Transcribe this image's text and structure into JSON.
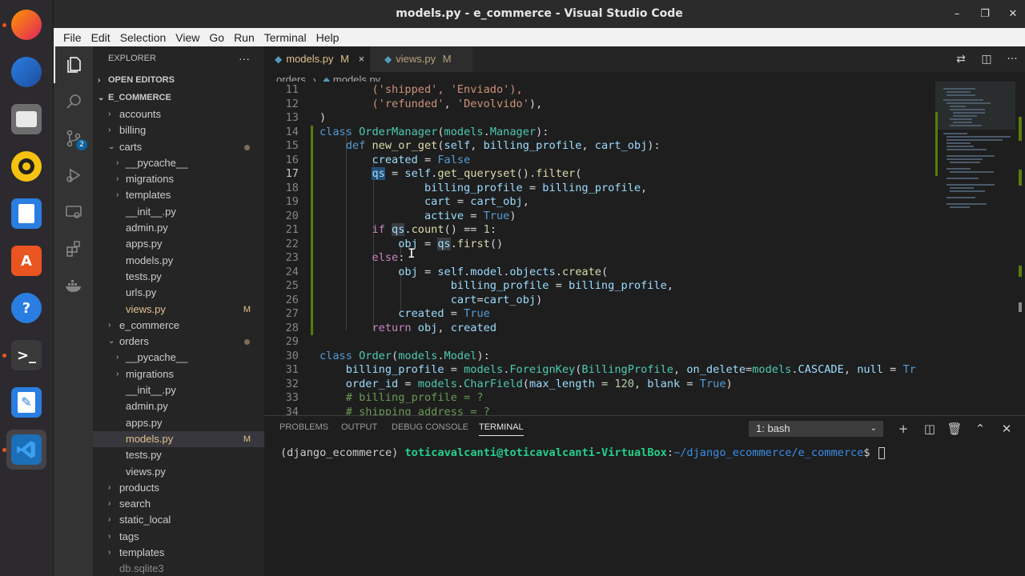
{
  "window": {
    "title": "models.py - e_commerce - Visual Studio Code"
  },
  "menu": [
    "File",
    "Edit",
    "Selection",
    "View",
    "Go",
    "Run",
    "Terminal",
    "Help"
  ],
  "dock": {
    "apps": [
      "firefox-icon",
      "thunderbird-icon",
      "files-icon",
      "rhythmbox-icon",
      "writer-icon",
      "software-center-icon",
      "help-icon",
      "terminal-icon",
      "text-editor-icon",
      "vscode-icon"
    ],
    "terminal_glyph": ">_",
    "help_glyph": "?",
    "software_glyph": "A"
  },
  "activity": {
    "scm_badge": "2"
  },
  "sidebar": {
    "title": "EXPLORER",
    "more": "···",
    "open_editors": "OPEN EDITORS",
    "root": "E_COMMERCE",
    "items": [
      {
        "label": "accounts",
        "indent": 1,
        "chev": "›"
      },
      {
        "label": "billing",
        "indent": 1,
        "chev": "›"
      },
      {
        "label": "carts",
        "indent": 1,
        "chev": "⌄",
        "dot": true
      },
      {
        "label": "__pycache__",
        "indent": 2,
        "chev": "›"
      },
      {
        "label": "migrations",
        "indent": 2,
        "chev": "›"
      },
      {
        "label": "templates",
        "indent": 2,
        "chev": "›"
      },
      {
        "label": "__init__.py",
        "indent": 2
      },
      {
        "label": "admin.py",
        "indent": 2
      },
      {
        "label": "apps.py",
        "indent": 2
      },
      {
        "label": "models.py",
        "indent": 2
      },
      {
        "label": "tests.py",
        "indent": 2
      },
      {
        "label": "urls.py",
        "indent": 2
      },
      {
        "label": "views.py",
        "indent": 2,
        "modified": "M"
      },
      {
        "label": "e_commerce",
        "indent": 1,
        "chev": "›"
      },
      {
        "label": "orders",
        "indent": 1,
        "chev": "⌄",
        "dot": true
      },
      {
        "label": "__pycache__",
        "indent": 2,
        "chev": "›"
      },
      {
        "label": "migrations",
        "indent": 2,
        "chev": "›"
      },
      {
        "label": "__init__.py",
        "indent": 2
      },
      {
        "label": "admin.py",
        "indent": 2
      },
      {
        "label": "apps.py",
        "indent": 2
      },
      {
        "label": "models.py",
        "indent": 2,
        "modified": "M",
        "selected": true
      },
      {
        "label": "tests.py",
        "indent": 2
      },
      {
        "label": "views.py",
        "indent": 2
      },
      {
        "label": "products",
        "indent": 1,
        "chev": "›"
      },
      {
        "label": "search",
        "indent": 1,
        "chev": "›"
      },
      {
        "label": "static_local",
        "indent": 1,
        "chev": "›"
      },
      {
        "label": "tags",
        "indent": 1,
        "chev": "›"
      },
      {
        "label": "templates",
        "indent": 1,
        "chev": "›"
      },
      {
        "label": "db.sqlite3",
        "indent": 1,
        "dim": true
      }
    ]
  },
  "tabs": [
    {
      "label": "models.py",
      "badge": "M",
      "active": true,
      "close": "×"
    },
    {
      "label": "views.py",
      "badge": "M",
      "active": false
    }
  ],
  "breadcrumb": {
    "folder": "orders",
    "sep": "›",
    "file": "models.py"
  },
  "code": {
    "lines": [
      {
        "n": "11",
        "html": "        <span class='str'>('shipped', 'Enviado'),</span>"
      },
      {
        "n": "12",
        "html": "        <span class='str'>('refunded'</span>, <span class='str'>'Devolvido'</span>),"
      },
      {
        "n": "13",
        "html": ")"
      },
      {
        "n": "14",
        "html": "<span class='kw'>class</span> <span class='cls'>OrderManager</span>(<span class='cls'>models</span>.<span class='cls'>Manager</span>):",
        "mod": true
      },
      {
        "n": "15",
        "html": "    <span class='kw'>def</span> <span class='fn'>new_or_get</span>(<span class='var'>self</span>, <span class='var'>billing_profile</span>, <span class='var'>cart_obj</span>):",
        "mod": true
      },
      {
        "n": "16",
        "html": "        <span class='var'>created</span> = <span class='kw'>False</span>",
        "mod": true
      },
      {
        "n": "17",
        "html": "        <span class='var hl'>qs</span> = <span class='var'>self</span>.<span class='fn'>get_queryset</span>().<span class='fn'>filter</span>(",
        "mod": true,
        "cur": true
      },
      {
        "n": "18",
        "html": "                <span class='var'>billing_profile</span> = <span class='var'>billing_profile</span>,",
        "mod": true
      },
      {
        "n": "19",
        "html": "                <span class='var'>cart</span> = <span class='var'>cart_obj</span>,",
        "mod": true
      },
      {
        "n": "20",
        "html": "                <span class='var'>active</span> = <span class='kw'>True</span>)",
        "mod": true
      },
      {
        "n": "21",
        "html": "        <span class='kw2'>if</span> <span class='var hl2'>qs</span>.<span class='fn'>count</span>() == <span class='num'>1</span>:",
        "mod": true
      },
      {
        "n": "22",
        "html": "            <span class='var'>obj</span> = <span class='var hl2'>qs</span>.<span class='fn'>first</span>()",
        "mod": true
      },
      {
        "n": "23",
        "html": "        <span class='kw2'>else</span>:",
        "mod": true
      },
      {
        "n": "24",
        "html": "            <span class='var'>obj</span> = <span class='var'>self</span>.<span class='var'>model</span>.<span class='var'>objects</span>.<span class='fn'>create</span>(",
        "mod": true
      },
      {
        "n": "25",
        "html": "                    <span class='var'>billing_profile</span> = <span class='var'>billing_profile</span>,",
        "mod": true
      },
      {
        "n": "26",
        "html": "                    <span class='var'>cart</span>=<span class='var'>cart_obj</span>)",
        "mod": true
      },
      {
        "n": "27",
        "html": "            <span class='var'>created</span> = <span class='kw'>True</span>",
        "mod": true
      },
      {
        "n": "28",
        "html": "        <span class='kw2'>return</span> <span class='var'>obj</span>, <span class='var'>created</span>",
        "mod": true
      },
      {
        "n": "29",
        "html": ""
      },
      {
        "n": "30",
        "html": "<span class='kw'>class</span> <span class='cls'>Order</span>(<span class='cls'>models</span>.<span class='cls'>Model</span>):"
      },
      {
        "n": "31",
        "html": "    <span class='var'>billing_profile</span> = <span class='cls'>models</span>.<span class='cls'>ForeignKey</span>(<span class='cls'>BillingProfile</span>, <span class='var'>on_delete</span>=<span class='cls'>models</span>.<span class='var'>CASCADE</span>, <span class='var'>null</span> = <span class='kw'>Tr</span>"
      },
      {
        "n": "32",
        "html": "    <span class='var'>order_id</span> = <span class='cls'>models</span>.<span class='cls'>CharField</span>(<span class='var'>max_length</span> = <span class='num'>120</span>, <span class='var'>blank</span> = <span class='kw'>True</span>)"
      },
      {
        "n": "33",
        "html": "    <span class='com'># billing_profile = ?</span>"
      },
      {
        "n": "34",
        "html": "    <span class='com'># shipping_address = ?</span>"
      }
    ]
  },
  "panel": {
    "tabs": [
      "PROBLEMS",
      "OUTPUT",
      "DEBUG CONSOLE",
      "TERMINAL"
    ],
    "terminal_select": "1: bash",
    "terminal": {
      "env": "(django_ecommerce) ",
      "user": "toticavalcanti@toticavalcanti-VirtualBox",
      "colon": ":",
      "path": "~/django_ecommerce/e_commerce",
      "prompt": "$ "
    }
  }
}
